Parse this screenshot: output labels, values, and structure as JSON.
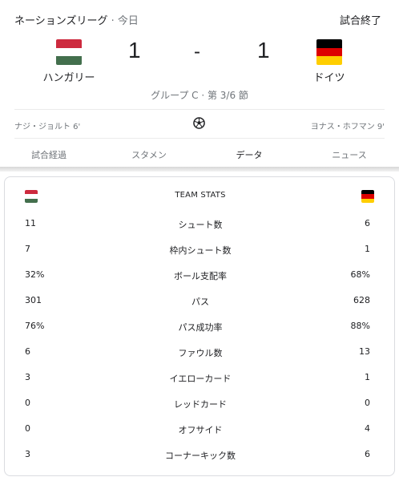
{
  "match": {
    "league": "ネーションズリーグ",
    "separator": "·",
    "date": "今日",
    "status": "試合終了",
    "group": "グループ C · 第 3/6 節"
  },
  "home": {
    "name": "ハンガリー",
    "score": "1",
    "scorer": "ナジ・ジョルト 6'",
    "flag_colors": [
      "#cd2a3e",
      "#ffffff",
      "#436f4d"
    ]
  },
  "away": {
    "name": "ドイツ",
    "score": "1",
    "scorer": "ヨナス・ホフマン 9'",
    "flag_colors": [
      "#000000",
      "#dd0000",
      "#ffce00"
    ]
  },
  "score_separator": "-",
  "icons": {
    "goal": "soccer-ball-icon"
  },
  "tabs": [
    {
      "label": "試合経過",
      "active": false
    },
    {
      "label": "スタメン",
      "active": false
    },
    {
      "label": "データ",
      "active": true
    },
    {
      "label": "ニュース",
      "active": false
    }
  ],
  "stats": {
    "title": "TEAM STATS",
    "rows": [
      {
        "home": "11",
        "label": "シュート数",
        "away": "6"
      },
      {
        "home": "7",
        "label": "枠内シュート数",
        "away": "1"
      },
      {
        "home": "32%",
        "label": "ボール支配率",
        "away": "68%"
      },
      {
        "home": "301",
        "label": "パス",
        "away": "628"
      },
      {
        "home": "76%",
        "label": "パス成功率",
        "away": "88%"
      },
      {
        "home": "6",
        "label": "ファウル数",
        "away": "13"
      },
      {
        "home": "3",
        "label": "イエローカード",
        "away": "1"
      },
      {
        "home": "0",
        "label": "レッドカード",
        "away": "0"
      },
      {
        "home": "0",
        "label": "オフサイド",
        "away": "4"
      },
      {
        "home": "3",
        "label": "コーナーキック数",
        "away": "6"
      }
    ]
  }
}
